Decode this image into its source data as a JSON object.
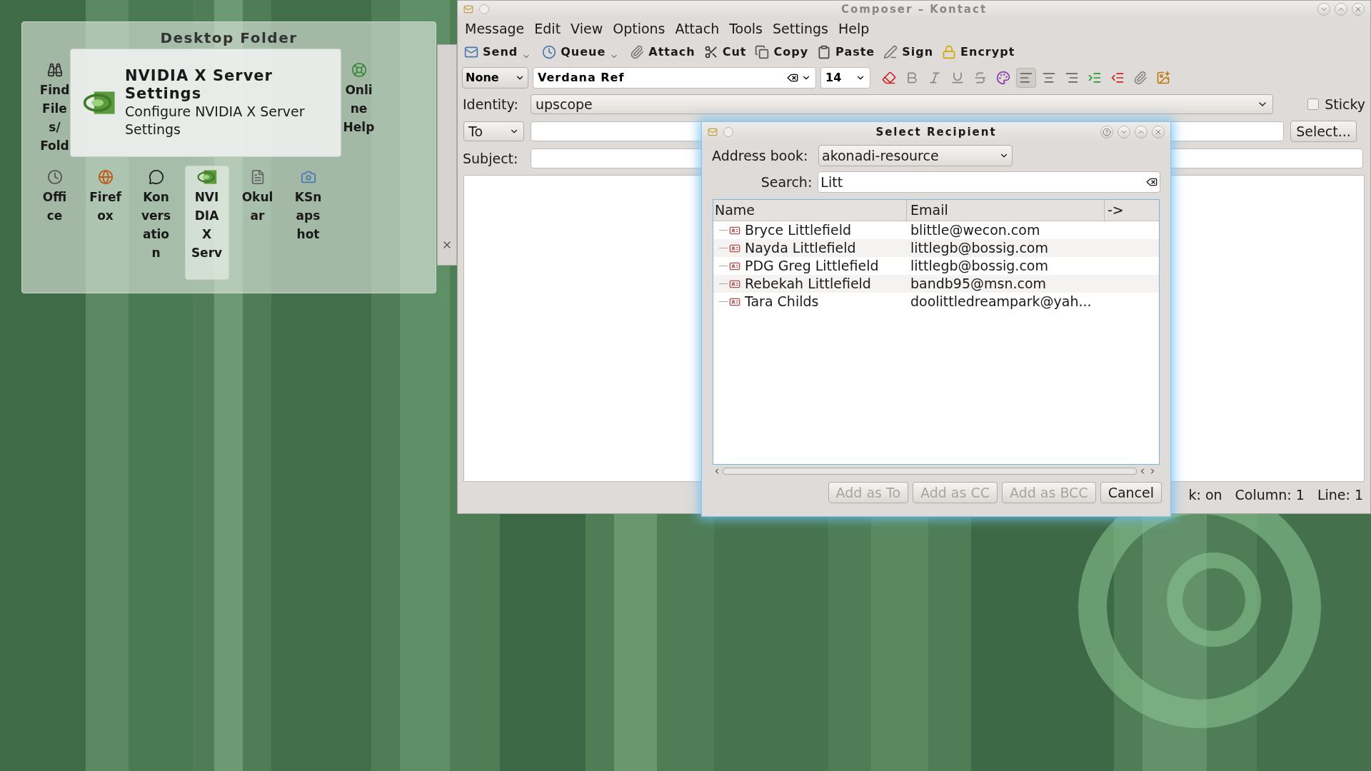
{
  "desktop_folder": {
    "title": "Desktop Folder",
    "icon_rows": [
      [
        {
          "kind": "binoculars",
          "lines": [
            "Find",
            "File",
            "s/",
            "Fold"
          ],
          "selected": false
        },
        {
          "kind": "help",
          "lines": [
            "Onli",
            "ne",
            "Help"
          ],
          "selected": false
        }
      ],
      [
        {
          "kind": "office",
          "lines": [
            "Offi",
            "ce"
          ],
          "selected": false
        },
        {
          "kind": "globe",
          "lines": [
            "Firef",
            "ox"
          ],
          "selected": false
        },
        {
          "kind": "chat",
          "lines": [
            "Kon",
            "vers",
            "atio",
            "n"
          ],
          "selected": false
        },
        {
          "kind": "nvidia",
          "lines": [
            "NVI",
            "DIA",
            "X",
            "Serv"
          ],
          "selected": true
        },
        {
          "kind": "document",
          "lines": [
            "Okul",
            "ar"
          ],
          "selected": false
        },
        {
          "kind": "camera",
          "lines": [
            "KSn",
            "aps",
            "hot"
          ],
          "selected": false
        }
      ]
    ],
    "tooltip": {
      "title": "NVIDIA X Server Settings",
      "description": "Configure NVIDIA X Server Settings"
    }
  },
  "composer": {
    "title": "Composer – Kontact",
    "menu": [
      "Message",
      "Edit",
      "View",
      "Options",
      "Attach",
      "Tools",
      "Settings",
      "Help"
    ],
    "toolbar": [
      {
        "kind": "send",
        "label": "Send",
        "dropdown": true
      },
      {
        "kind": "queue",
        "label": "Queue",
        "dropdown": true
      },
      {
        "kind": "attach",
        "label": "Attach",
        "dropdown": false
      },
      {
        "kind": "cut",
        "label": "Cut",
        "dropdown": false
      },
      {
        "kind": "copy",
        "label": "Copy",
        "dropdown": false
      },
      {
        "kind": "paste",
        "label": "Paste",
        "dropdown": false
      },
      {
        "kind": "sign",
        "label": "Sign",
        "dropdown": false
      },
      {
        "kind": "encrypt",
        "label": "Encrypt",
        "dropdown": false
      }
    ],
    "format_bar": {
      "style": "None",
      "font": "Verdana Ref",
      "size": "14",
      "buttons": [
        {
          "kind": "eraser",
          "selected": false
        },
        {
          "kind": "bold",
          "selected": false
        },
        {
          "kind": "italic",
          "selected": false
        },
        {
          "kind": "underline",
          "selected": false
        },
        {
          "kind": "strike",
          "selected": false
        },
        {
          "kind": "color",
          "selected": false
        },
        {
          "kind": "align-left",
          "selected": true
        },
        {
          "kind": "align-center",
          "selected": false
        },
        {
          "kind": "align-right",
          "selected": false
        },
        {
          "kind": "indent",
          "selected": false
        },
        {
          "kind": "outdent",
          "selected": false
        },
        {
          "kind": "attach-add",
          "selected": false
        },
        {
          "kind": "image-add",
          "selected": false
        }
      ]
    },
    "identity": {
      "label": "Identity:",
      "value": "upscope"
    },
    "sticky": {
      "label": "Sticky",
      "checked": false
    },
    "recipient": {
      "type": "To",
      "select_button": "Select..."
    },
    "subject": {
      "label": "Subject:"
    },
    "status_bar": [
      "k: on",
      "Column: 1",
      "Line: 1"
    ]
  },
  "dialog": {
    "title": "Select Recipient",
    "address_book": {
      "label": "Address book:",
      "value": "akonadi-resource"
    },
    "search": {
      "label": "Search:",
      "value": "Litt"
    },
    "columns": [
      "Name",
      "Email",
      "->"
    ],
    "rows": [
      {
        "name": "Bryce Littlefield",
        "email": "blittle@wecon.com"
      },
      {
        "name": "Nayda Littlefield",
        "email": "littlegb@bossig.com"
      },
      {
        "name": "PDG Greg Littlefield",
        "email": "littlegb@bossig.com"
      },
      {
        "name": "Rebekah Littlefield",
        "email": "bandb95@msn.com"
      },
      {
        "name": "Tara Childs",
        "email": "doolittledreampark@yah..."
      }
    ],
    "buttons": [
      {
        "label": "Add as To",
        "disabled": true
      },
      {
        "label": "Add as CC",
        "disabled": true
      },
      {
        "label": "Add as BCC",
        "disabled": true
      },
      {
        "label": "Cancel",
        "disabled": false
      }
    ]
  }
}
